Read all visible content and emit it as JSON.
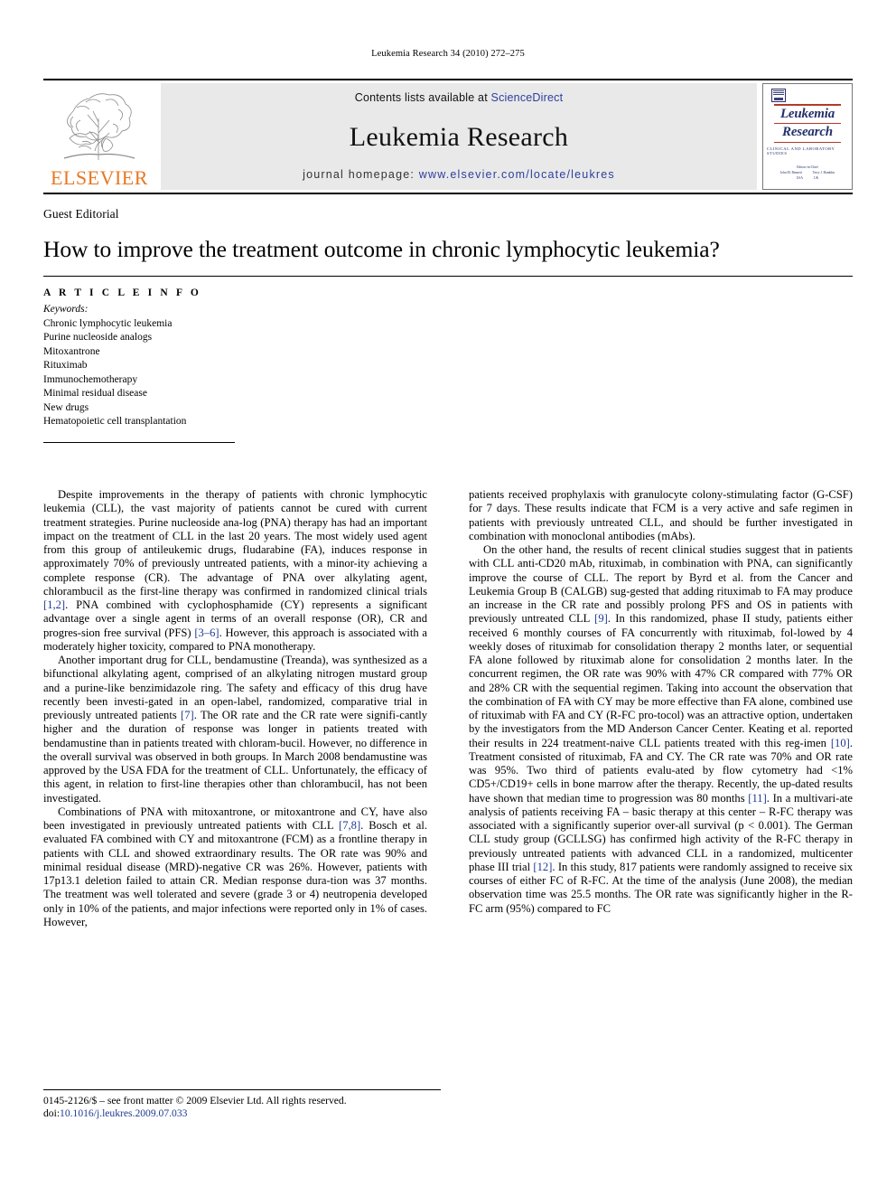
{
  "running_head": "Leukemia Research 34 (2010) 272–275",
  "masthead": {
    "publisher_name": "ELSEVIER",
    "contents_prefix": "Contents lists available at ",
    "contents_link": "ScienceDirect",
    "journal_title": "Leukemia Research",
    "homepage_prefix": "journal homepage: ",
    "homepage_url": "www.elsevier.com/locate/leukres",
    "link_color": "#2b3f9e",
    "elsevier_orange": "#E87722"
  },
  "cover": {
    "title_line1": "Leukemia",
    "title_line2": "Research",
    "subtitle": "Clinical and Laboratory Studies",
    "editors_label": "Editors-in-Chief",
    "editor1_name": "John M. Bennett",
    "editor1_place": "USA",
    "editor2_name": "Terry J. Hamblin",
    "editor2_place": "UK",
    "title_color": "#24306b",
    "rule_color": "#b13a2a"
  },
  "article": {
    "section_label": "Guest Editorial",
    "title": "How to improve the treatment outcome in chronic lymphocytic leukemia?"
  },
  "article_info": {
    "heading": "A R T I C L E   I N F O",
    "keywords_label": "Keywords:",
    "keywords": [
      "Chronic lymphocytic leukemia",
      "Purine nucleoside analogs",
      "Mitoxantrone",
      "Rituximab",
      "Immunochemotherapy",
      "Minimal residual disease",
      "New drugs",
      "Hematopoietic cell transplantation"
    ]
  },
  "body": {
    "left_column": [
      {
        "indent": true,
        "html": "Despite improvements in the therapy of patients with chronic lymphocytic leukemia (CLL), the vast majority of patients cannot be cured with current treatment strategies. Purine nucleoside ana-log (PNA) therapy has had an important impact on the treatment of CLL in the last 20 years. The most widely used agent from this group of antileukemic drugs, fludarabine (FA), induces response in approximately 70% of previously untreated patients, with a minor-ity achieving a complete response (CR). The advantage of PNA over alkylating agent, chlorambucil as the first-line therapy was confirmed in randomized clinical trials <span class=\"ref\">[1,2]</span>. PNA combined with cyclophosphamide (CY) represents a significant advantage over a single agent in terms of an overall response (OR), CR and progres-sion free survival (PFS) <span class=\"ref\">[3–6]</span>. However, this approach is associated with a moderately higher toxicity, compared to PNA monotherapy."
      },
      {
        "indent": true,
        "html": "Another important drug for CLL, bendamustine (Treanda), was synthesized as a bifunctional alkylating agent, comprised of an alkylating nitrogen mustard group and a purine-like benzimidazole ring. The safety and efficacy of this drug have recently been investi-gated in an open-label, randomized, comparative trial in previously untreated patients <span class=\"ref\">[7]</span>. The OR rate and the CR rate were signifi-cantly higher and the duration of response was longer in patients treated with bendamustine than in patients treated with chloram-bucil. However, no difference in the overall survival was observed in both groups. In March 2008 bendamustine was approved by the USA FDA for the treatment of CLL. Unfortunately, the efficacy of this agent, in relation to first-line therapies other than chlorambucil, has not been investigated."
      },
      {
        "indent": true,
        "html": "Combinations of PNA with mitoxantrone, or mitoxantrone and CY, have also been investigated in previously untreated patients with CLL <span class=\"ref\">[7,8]</span>. Bosch et al. evaluated FA combined with CY and mitoxantrone (FCM) as a frontline therapy in patients with CLL and showed extraordinary results. The OR rate was 90% and minimal residual disease (MRD)-negative CR was 26%. However, patients with 17p13.1 deletion failed to attain CR. Median response dura-tion was 37 months. The treatment was well tolerated and severe (grade 3 or 4) neutropenia developed only in 10% of the patients, and major infections were reported only in 1% of cases. However,"
      }
    ],
    "right_column": [
      {
        "indent": false,
        "html": "patients received prophylaxis with granulocyte colony-stimulating factor (G-CSF) for 7 days. These results indicate that FCM is a very active and safe regimen in patients with previously untreated CLL, and should be further investigated in combination with monoclonal antibodies (mAbs)."
      },
      {
        "indent": true,
        "html": "On the other hand, the results of recent clinical studies suggest that in patients with CLL anti-CD20 mAb, rituximab, in combination with PNA, can significantly improve the course of CLL. The report by Byrd et al. from the Cancer and Leukemia Group B (CALGB) sug-gested that adding rituximab to FA may produce an increase in the CR rate and possibly prolong PFS and OS in patients with previously untreated CLL <span class=\"ref\">[9]</span>. In this randomized, phase II study, patients either received 6 monthly courses of FA concurrently with rituximab, fol-lowed by 4 weekly doses of rituximab for consolidation therapy 2 months later, or sequential FA alone followed by rituximab alone for consolidation 2 months later. In the concurrent regimen, the OR rate was 90% with 47% CR compared with 77% OR and 28% CR with the sequential regimen. Taking into account the observation that the combination of FA with CY may be more effective than FA alone, combined use of rituximab with FA and CY (R-FC pro-tocol) was an attractive option, undertaken by the investigators from the MD Anderson Cancer Center. Keating et al. reported their results in 224 treatment-naive CLL patients treated with this reg-imen <span class=\"ref\">[10]</span>. Treatment consisted of rituximab, FA and CY. The CR rate was 70% and OR rate was 95%. Two third of patients evalu-ated by flow cytometry had &lt;1% CD5+/CD19+ cells in bone marrow after the therapy. Recently, the up-dated results have shown that median time to progression was 80 months <span class=\"ref\">[11]</span>. In a multivari-ate analysis of patients receiving FA – basic therapy at this center – R-FC therapy was associated with a significantly superior over-all survival (p &lt; 0.001). The German CLL study group (GCLLSG) has confirmed high activity of the R-FC therapy in previously untreated patients with advanced CLL in a randomized, multicenter phase III trial <span class=\"ref\">[12]</span>. In this study, 817 patients were randomly assigned to receive six courses of either FC of R-FC. At the time of the analysis (June 2008), the median observation time was 25.5 months. The OR rate was significantly higher in the R-FC arm (95%) compared to FC"
      }
    ]
  },
  "footer": {
    "copyright": "0145-2126/$ – see front matter © 2009 Elsevier Ltd. All rights reserved.",
    "doi_prefix": "doi:",
    "doi": "10.1016/j.leukres.2009.07.033"
  }
}
